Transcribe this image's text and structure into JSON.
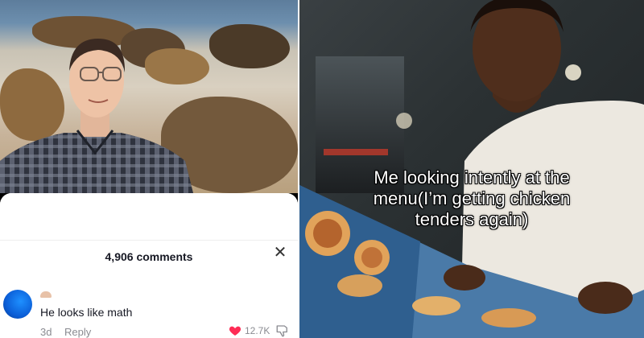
{
  "left_panel": {
    "comments": {
      "count_label": "4,906 comments",
      "close_icon": "close-icon"
    },
    "comment": {
      "text": "He looks like math",
      "age": "3d",
      "reply_label": "Reply",
      "likes": "12.7K",
      "like_icon": "heart-icon",
      "dislike_icon": "dislike-icon"
    },
    "colors": {
      "heart": "#fe2c55",
      "muted": "#8a8b91"
    }
  },
  "right_panel": {
    "caption_lines": [
      "Me looking intently at the",
      "menu(I’m getting chicken",
      "tenders again)"
    ]
  }
}
